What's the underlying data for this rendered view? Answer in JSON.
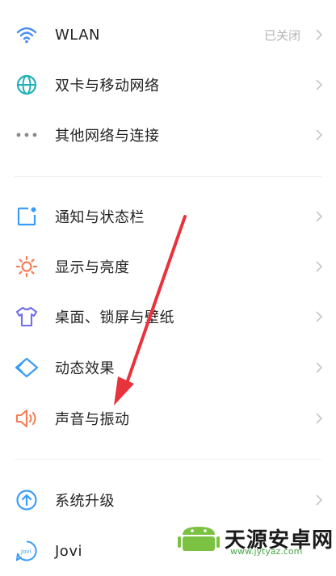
{
  "settings": {
    "group1": [
      {
        "label": "WLAN",
        "value": "已关闭",
        "icon": "wifi-icon",
        "color": "#4a8df6"
      },
      {
        "label": "双卡与移动网络",
        "value": "",
        "icon": "globe-icon",
        "color": "#1fb1b7"
      },
      {
        "label": "其他网络与连接",
        "value": "",
        "icon": "more-dots-icon",
        "color": "#8a8a8a"
      }
    ],
    "group2": [
      {
        "label": "通知与状态栏",
        "icon": "notification-square-icon",
        "color": "#3a9df7"
      },
      {
        "label": "显示与亮度",
        "icon": "sun-icon",
        "color": "#f47d55"
      },
      {
        "label": "桌面、锁屏与壁纸",
        "icon": "tshirt-icon",
        "color": "#6f6fe8"
      },
      {
        "label": "动态效果",
        "icon": "diamond-icon",
        "color": "#3a9df7"
      },
      {
        "label": "声音与振动",
        "icon": "speaker-icon",
        "color": "#f47d55"
      }
    ],
    "group3": [
      {
        "label": "系统升级",
        "icon": "upgrade-arrow-icon",
        "color": "#3a9df7"
      },
      {
        "label": "Jovi",
        "icon": "jovi-icon",
        "color": "#3a9df7"
      }
    ]
  },
  "watermark": {
    "brand": "天源安卓网",
    "url": "www.jytyaz.com"
  },
  "colors": {
    "annotation_arrow": "#e8323c",
    "chevron": "#c6c6c6"
  }
}
